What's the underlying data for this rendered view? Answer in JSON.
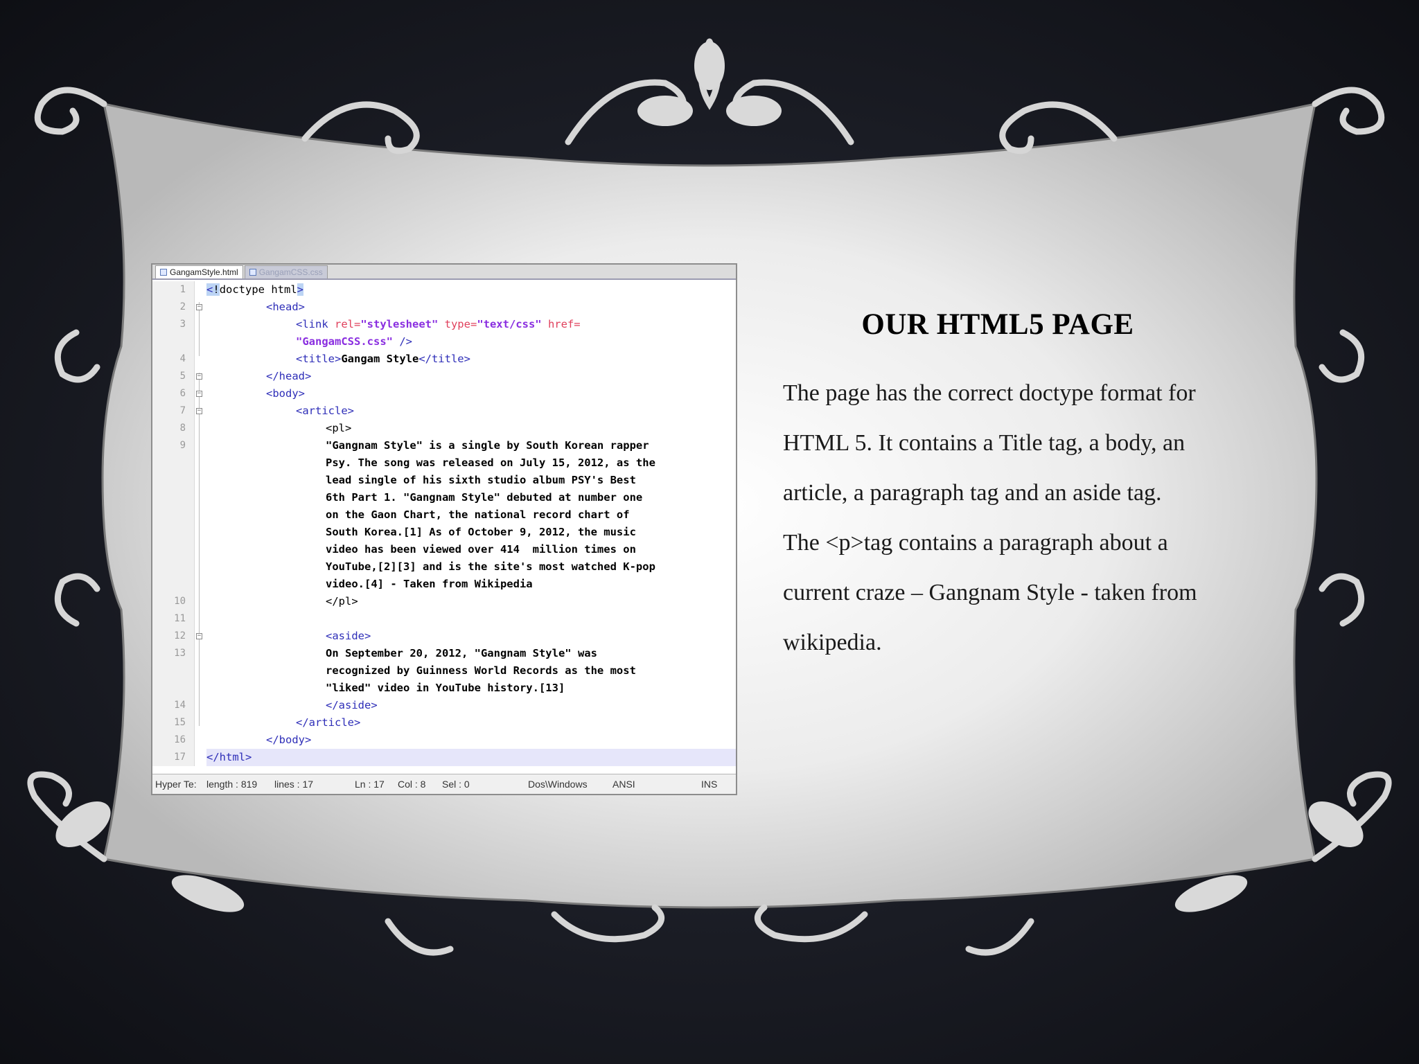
{
  "slide": {
    "title": "OUR HTML5 PAGE",
    "body": "The page has the correct doctype format for HTML 5. It contains a Title tag, a body, an article, a paragraph tag and an aside tag. The <p>tag contains a paragraph about a current craze – Gangnam Style - taken from wikipedia."
  },
  "editor": {
    "tabs": [
      {
        "label": "GangamStyle.html",
        "icon": "html-file-icon",
        "active": true
      },
      {
        "label": "GangamCSS.css",
        "icon": "css-file-icon",
        "active": false
      }
    ],
    "line_numbers": [
      "1",
      "2",
      "3",
      "",
      "4",
      "5",
      "6",
      "7",
      "8",
      "9",
      "",
      "",
      "",
      "",
      "",
      "",
      "",
      "",
      "10",
      "11",
      "12",
      "13",
      "",
      "",
      "14",
      "15",
      "16",
      "17"
    ],
    "code": {
      "l1_a": "<",
      "l1_b": "!",
      "l1_c": "doctype html",
      "l1_d": ">",
      "l2": "<head>",
      "l3_a": "<link ",
      "l3_b": "rel=",
      "l3_c": "\"stylesheet\"",
      "l3_d": " type=",
      "l3_e": "\"text/css\"",
      "l3_f": " href=",
      "l3b_a": "\"GangamCSS.css\"",
      "l3b_b": " />",
      "l4_a": "<title>",
      "l4_b": "Gangam Style",
      "l4_c": "</title>",
      "l5": "</head>",
      "l6": "<body>",
      "l7": "<article>",
      "l8": "<pl>",
      "p1": "\"Gangnam Style\" is a single by South Korean rapper",
      "p2": "Psy. The song was released on July 15, 2012, as the",
      "p3": "lead single of his sixth studio album PSY's Best",
      "p4": "6th Part 1. \"Gangnam Style\" debuted at number one",
      "p5": "on the Gaon Chart, the national record chart of",
      "p6": "South Korea.[1] As of October 9, 2012, the music",
      "p7": "video has been viewed over 414  million times on",
      "p8": "YouTube,[2][3] and is the site's most watched K-pop",
      "p9": "video.[4] - Taken from Wikipedia",
      "l10": "</pl>",
      "l12": "<aside>",
      "a1": "On September 20, 2012, \"Gangnam Style\" was",
      "a2": "recognized by Guinness World Records as the most",
      "a3": "\"liked\" video in YouTube history.[13]",
      "l14": "</aside>",
      "l15": "</article>",
      "l16": "</body>",
      "l17": "</html>"
    },
    "status": {
      "type": "Hyper Te:",
      "length": "length : 819",
      "lines": "lines : 17",
      "ln": "Ln : 17",
      "col": "Col : 8",
      "sel": "Sel : 0",
      "eol": "Dos\\Windows",
      "encoding": "ANSI",
      "mode": "INS"
    }
  },
  "colors": {
    "background": "#15171e",
    "frame": "#dcdcdc",
    "tag": "#2e2eb8",
    "attribute": "#e0405c",
    "value": "#8a2ee0"
  }
}
